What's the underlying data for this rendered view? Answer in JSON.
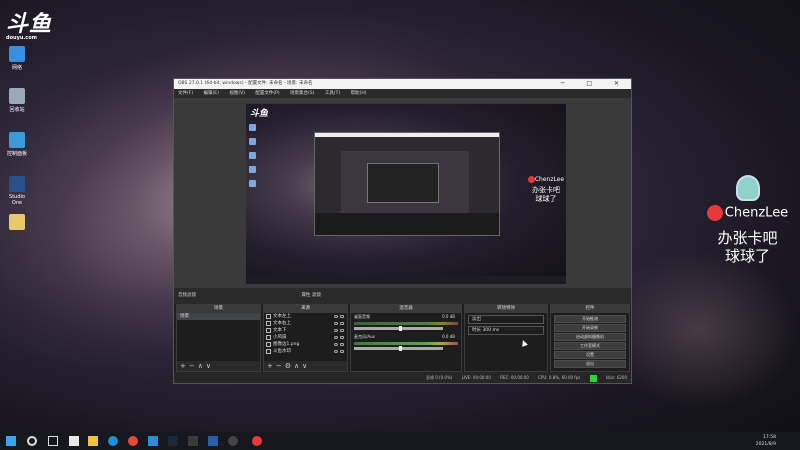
{
  "desktop": {
    "logo_text": "斗鱼",
    "logo_sub": "douyu.com",
    "icons": [
      {
        "label": "网络",
        "icon": "network-icon"
      },
      {
        "label": "回收站",
        "icon": "recycle-bin-icon"
      },
      {
        "label": "控制面板",
        "icon": "control-panel-icon"
      },
      {
        "label": "Studio One",
        "icon": "studio-one-icon"
      },
      {
        "label": "",
        "icon": "file-icon"
      }
    ],
    "brand_name": "ChenzLee",
    "brand_line1": "办张卡吧",
    "brand_line2": "球球了"
  },
  "obs": {
    "title": "OBS 27.0.1 (64-bit, windows) - 配置文件: 未命名 - 场景: 未命名",
    "menu": [
      "文件(F)",
      "编辑(E)",
      "视图(V)",
      "配置文件(P)",
      "场景集合(S)",
      "工具(T)",
      "帮助(H)"
    ],
    "scene_bar_left": "音频滤镜",
    "scene_bar_right": "属性   滤镜",
    "docks": {
      "scenes": {
        "title": "场景",
        "items": [
          "场景"
        ]
      },
      "sources": {
        "title": "来源",
        "items": [
          "文本左上",
          "文本右上",
          "文本下",
          "小风扇",
          "图像边1.png",
          "斗鱼水印"
        ]
      },
      "mixer": {
        "title": "混音器",
        "channels": [
          {
            "name": "桌面音频",
            "db": "0.0 dB"
          },
          {
            "name": "麦克风/Aux",
            "db": "0.0 dB"
          }
        ]
      },
      "transitions": {
        "title": "转场特效",
        "type": "淡出",
        "duration_label": "时长",
        "duration": "300 ms"
      },
      "controls": {
        "title": "控件",
        "buttons": [
          "开始推流",
          "开始录制",
          "启动虚拟摄像机",
          "工作室模式",
          "设置",
          "退出"
        ]
      }
    },
    "status": {
      "dropped": "丢帧 0 (0.0%)",
      "live": "LIVE: 00:00:00",
      "rec": "REC: 00:00:00",
      "cpu": "CPU: 0.8%, 60.00 fps",
      "kbps": "kb/s: 6200"
    }
  },
  "taskbar": {
    "time": "17:58",
    "date": "2021/8/9"
  }
}
